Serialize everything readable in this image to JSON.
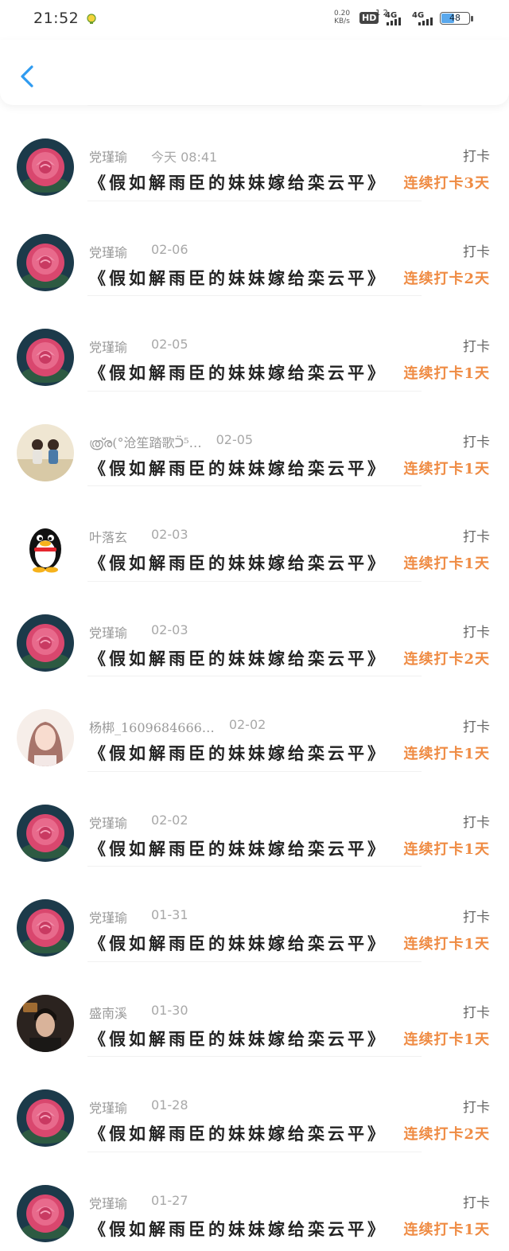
{
  "status_bar": {
    "time": "21:52",
    "net_speed_value": "0.20",
    "net_speed_unit": "KB/s",
    "hd_label": "HD",
    "hd_sub": "1 2",
    "signal1": "4G",
    "signal2": "4G",
    "battery": "48"
  },
  "colors": {
    "accent": "#2f9bf0",
    "streak": "#ef8b43",
    "avatar_rose": "#e2557a",
    "avatar_bg": "#1c3a4a"
  },
  "checkins": [
    {
      "name": "党瑾瑜",
      "date": "今天 08:41",
      "book": "《假如解雨臣的妹妹嫁给栾云平》",
      "action": "打卡",
      "streak": "连续打卡3天",
      "avatar": "rose"
    },
    {
      "name": "党瑾瑜",
      "date": "02-06",
      "book": "《假如解雨臣的妹妹嫁给栾云平》",
      "action": "打卡",
      "streak": "连续打卡2天",
      "avatar": "rose"
    },
    {
      "name": "党瑾瑜",
      "date": "02-05",
      "book": "《假如解雨臣的妹妹嫁给栾云平》",
      "action": "打卡",
      "streak": "连续打卡1天",
      "avatar": "rose"
    },
    {
      "name": "ത്ര്ര(°沧笙踏歌ᑒ⁵…",
      "date": "02-05",
      "book": "《假如解雨臣的妹妹嫁给栾云平》",
      "action": "打卡",
      "streak": "连续打卡1天",
      "avatar": "kids"
    },
    {
      "name": "叶落玄",
      "date": "02-03",
      "book": "《假如解雨臣的妹妹嫁给栾云平》",
      "action": "打卡",
      "streak": "连续打卡1天",
      "avatar": "penguin"
    },
    {
      "name": "党瑾瑜",
      "date": "02-03",
      "book": "《假如解雨臣的妹妹嫁给栾云平》",
      "action": "打卡",
      "streak": "连续打卡2天",
      "avatar": "rose"
    },
    {
      "name": "杨梆_1609684666…",
      "date": "02-02",
      "book": "《假如解雨臣的妹妹嫁给栾云平》",
      "action": "打卡",
      "streak": "连续打卡1天",
      "avatar": "girl"
    },
    {
      "name": "党瑾瑜",
      "date": "02-02",
      "book": "《假如解雨臣的妹妹嫁给栾云平》",
      "action": "打卡",
      "streak": "连续打卡1天",
      "avatar": "rose"
    },
    {
      "name": "党瑾瑜",
      "date": "01-31",
      "book": "《假如解雨臣的妹妹嫁给栾云平》",
      "action": "打卡",
      "streak": "连续打卡1天",
      "avatar": "rose"
    },
    {
      "name": "盛南溪",
      "date": "01-30",
      "book": "《假如解雨臣的妹妹嫁给栾云平》",
      "action": "打卡",
      "streak": "连续打卡1天",
      "avatar": "man"
    },
    {
      "name": "党瑾瑜",
      "date": "01-28",
      "book": "《假如解雨臣的妹妹嫁给栾云平》",
      "action": "打卡",
      "streak": "连续打卡2天",
      "avatar": "rose"
    },
    {
      "name": "党瑾瑜",
      "date": "01-27",
      "book": "《假如解雨臣的妹妹嫁给栾云平》",
      "action": "打卡",
      "streak": "连续打卡1天",
      "avatar": "rose"
    }
  ]
}
